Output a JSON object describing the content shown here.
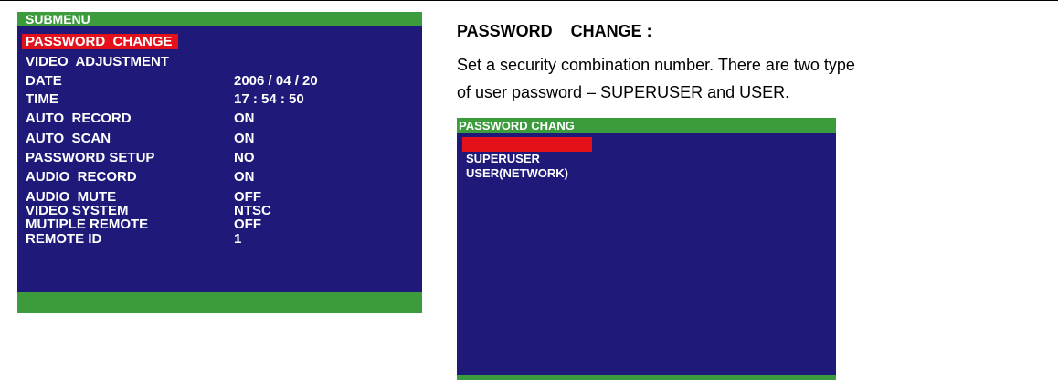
{
  "submenu": {
    "header": "SUBMENU",
    "items": [
      {
        "label": "PASSWORD  CHANGE",
        "value": ""
      },
      {
        "label": "VIDEO  ADJUSTMENT",
        "value": ""
      },
      {
        "label": "DATE",
        "value": "2006 / 04 / 20"
      },
      {
        "label": "TIME",
        "value": "17 : 54 : 50"
      },
      {
        "label": "AUTO  RECORD",
        "value": "ON"
      },
      {
        "label": "AUTO  SCAN",
        "value": "ON"
      },
      {
        "label": "PASSWORD SETUP",
        "value": "NO"
      },
      {
        "label": "AUDIO  RECORD",
        "value": "ON"
      },
      {
        "label": "AUDIO  MUTE",
        "value": "OFF"
      },
      {
        "label": "VIDEO SYSTEM",
        "value": "NTSC"
      },
      {
        "label": "MUTIPLE REMOTE",
        "value": "OFF"
      },
      {
        "label": "REMOTE ID",
        "value": "1"
      }
    ]
  },
  "section": {
    "title": "PASSWORD    CHANGE :",
    "desc_line1": "Set a security combination number. There are two type",
    "desc_line2": "of user password – SUPERUSER and USER."
  },
  "password_menu": {
    "header": "PASSWORD CHANG",
    "items": [
      "SUPERUSER",
      "USER(NETWORK)"
    ]
  },
  "colors": {
    "panel_bg": "#1f1a7a",
    "header_green": "#3c9b3c",
    "highlight_red": "#e5111a",
    "text_white": "#ffffff"
  }
}
